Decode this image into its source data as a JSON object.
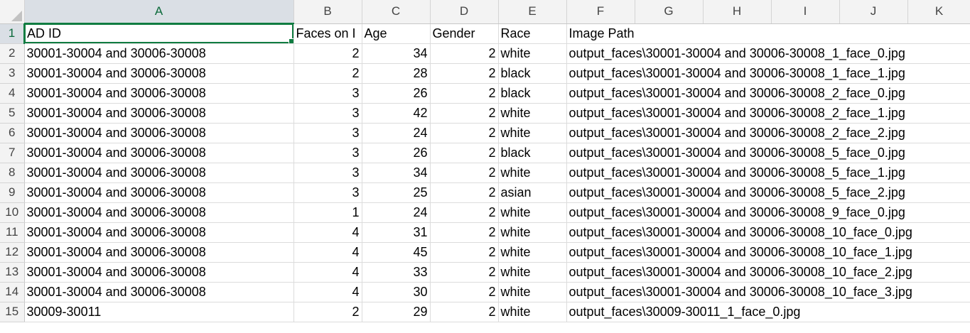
{
  "columns": [
    "A",
    "B",
    "C",
    "D",
    "E",
    "F",
    "G",
    "H",
    "I",
    "J",
    "K"
  ],
  "active_cell": "A1",
  "accent_color": "#107c41",
  "header_row": {
    "row_number": "1",
    "ad_id": "AD ID",
    "faces": "Faces on I",
    "age": "Age",
    "gender": "Gender",
    "race": "Race",
    "image_path": "Image Path"
  },
  "rows": [
    {
      "n": "2",
      "ad_id": "30001-30004 and 30006-30008",
      "faces": "2",
      "age": "34",
      "gender": "2",
      "race": "white",
      "path": "output_faces\\30001-30004 and 30006-30008_1_face_0.jpg"
    },
    {
      "n": "3",
      "ad_id": "30001-30004 and 30006-30008",
      "faces": "2",
      "age": "28",
      "gender": "2",
      "race": "black",
      "path": "output_faces\\30001-30004 and 30006-30008_1_face_1.jpg"
    },
    {
      "n": "4",
      "ad_id": "30001-30004 and 30006-30008",
      "faces": "3",
      "age": "26",
      "gender": "2",
      "race": "black",
      "path": "output_faces\\30001-30004 and 30006-30008_2_face_0.jpg"
    },
    {
      "n": "5",
      "ad_id": "30001-30004 and 30006-30008",
      "faces": "3",
      "age": "42",
      "gender": "2",
      "race": "white",
      "path": "output_faces\\30001-30004 and 30006-30008_2_face_1.jpg"
    },
    {
      "n": "6",
      "ad_id": "30001-30004 and 30006-30008",
      "faces": "3",
      "age": "24",
      "gender": "2",
      "race": "white",
      "path": "output_faces\\30001-30004 and 30006-30008_2_face_2.jpg"
    },
    {
      "n": "7",
      "ad_id": "30001-30004 and 30006-30008",
      "faces": "3",
      "age": "26",
      "gender": "2",
      "race": "black",
      "path": "output_faces\\30001-30004 and 30006-30008_5_face_0.jpg"
    },
    {
      "n": "8",
      "ad_id": "30001-30004 and 30006-30008",
      "faces": "3",
      "age": "34",
      "gender": "2",
      "race": "white",
      "path": "output_faces\\30001-30004 and 30006-30008_5_face_1.jpg"
    },
    {
      "n": "9",
      "ad_id": "30001-30004 and 30006-30008",
      "faces": "3",
      "age": "25",
      "gender": "2",
      "race": "asian",
      "path": "output_faces\\30001-30004 and 30006-30008_5_face_2.jpg"
    },
    {
      "n": "10",
      "ad_id": "30001-30004 and 30006-30008",
      "faces": "1",
      "age": "24",
      "gender": "2",
      "race": "white",
      "path": "output_faces\\30001-30004 and 30006-30008_9_face_0.jpg"
    },
    {
      "n": "11",
      "ad_id": "30001-30004 and 30006-30008",
      "faces": "4",
      "age": "31",
      "gender": "2",
      "race": "white",
      "path": "output_faces\\30001-30004 and 30006-30008_10_face_0.jpg"
    },
    {
      "n": "12",
      "ad_id": "30001-30004 and 30006-30008",
      "faces": "4",
      "age": "45",
      "gender": "2",
      "race": "white",
      "path": "output_faces\\30001-30004 and 30006-30008_10_face_1.jpg"
    },
    {
      "n": "13",
      "ad_id": "30001-30004 and 30006-30008",
      "faces": "4",
      "age": "33",
      "gender": "2",
      "race": "white",
      "path": "output_faces\\30001-30004 and 30006-30008_10_face_2.jpg"
    },
    {
      "n": "14",
      "ad_id": "30001-30004 and 30006-30008",
      "faces": "4",
      "age": "30",
      "gender": "2",
      "race": "white",
      "path": "output_faces\\30001-30004 and 30006-30008_10_face_3.jpg"
    },
    {
      "n": "15",
      "ad_id": "30009-30011",
      "faces": "2",
      "age": "29",
      "gender": "2",
      "race": "white",
      "path": "output_faces\\30009-30011_1_face_0.jpg"
    }
  ]
}
